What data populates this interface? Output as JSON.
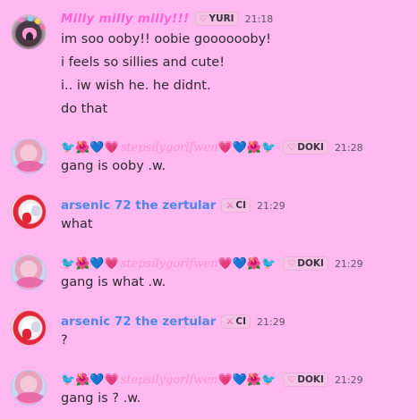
{
  "messages": [
    {
      "username": "Milly milly milly!!!",
      "tag": {
        "icon": "heart-outline-icon",
        "label": "YURI"
      },
      "time": "21:18",
      "lines": [
        "im soo ooby!! oobie gooooooby!",
        "i feels so sillies and cute!",
        "i.. iw wish he. he didnt.",
        "do that"
      ]
    },
    {
      "username_prefix": "🐦🌺💙💗",
      "username": "stepsilygorlfwen",
      "username_suffix": "💗💙🌺🐦",
      "tag": {
        "icon": "heart-outline-icon",
        "label": "DOKI"
      },
      "time": "21:28",
      "lines": [
        "gang is ooby .w."
      ]
    },
    {
      "username": "arsenic 72 the zertular",
      "tag": {
        "icon": "sword-icon",
        "label": "CI"
      },
      "time": "21:29",
      "lines": [
        "what"
      ]
    },
    {
      "username_prefix": "🐦🌺💙💗",
      "username": "stepsilygorlfwen",
      "username_suffix": "💗💙🌺🐦",
      "tag": {
        "icon": "heart-outline-icon",
        "label": "DOKI"
      },
      "time": "21:29",
      "lines": [
        "gang is what .w."
      ]
    },
    {
      "username": "arsenic 72 the zertular",
      "tag": {
        "icon": "sword-icon",
        "label": "CI"
      },
      "time": "21:29",
      "lines": [
        "?"
      ]
    },
    {
      "username_prefix": "🐦🌺💙💗",
      "username": "stepsilygorlfwen",
      "username_suffix": "💗💙🌺🐦",
      "tag": {
        "icon": "heart-outline-icon",
        "label": "DOKI"
      },
      "time": "21:29",
      "lines": [
        "gang is ? .w."
      ]
    }
  ],
  "colors": {
    "background": "#ffb8f0",
    "milly_name": "#ff63d6",
    "step_name": "#ff8fcf",
    "arsenic_name": "#4f86e8"
  }
}
